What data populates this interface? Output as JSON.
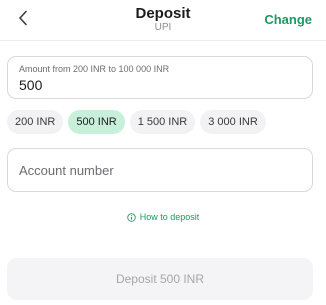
{
  "header": {
    "title": "Deposit",
    "subtitle": "UPI",
    "change_label": "Change",
    "back_icon": "chevron-left-icon"
  },
  "amount": {
    "label": "Amount from 200 INR to 100 000 INR",
    "value": "500"
  },
  "presets": [
    {
      "label": "200 INR",
      "selected": false
    },
    {
      "label": "500 INR",
      "selected": true
    },
    {
      "label": "1 500 INR",
      "selected": false
    },
    {
      "label": "3 000 INR",
      "selected": false
    }
  ],
  "account": {
    "placeholder": "Account number"
  },
  "help": {
    "label": "How to deposit",
    "icon": "info-icon"
  },
  "submit": {
    "label": "Deposit 500 INR",
    "enabled": false
  },
  "colors": {
    "accent": "#1c9a5f",
    "chip_selected": "#c7efd9",
    "chip": "#f2f2f4",
    "disabled_button": "#f4f4f6"
  }
}
